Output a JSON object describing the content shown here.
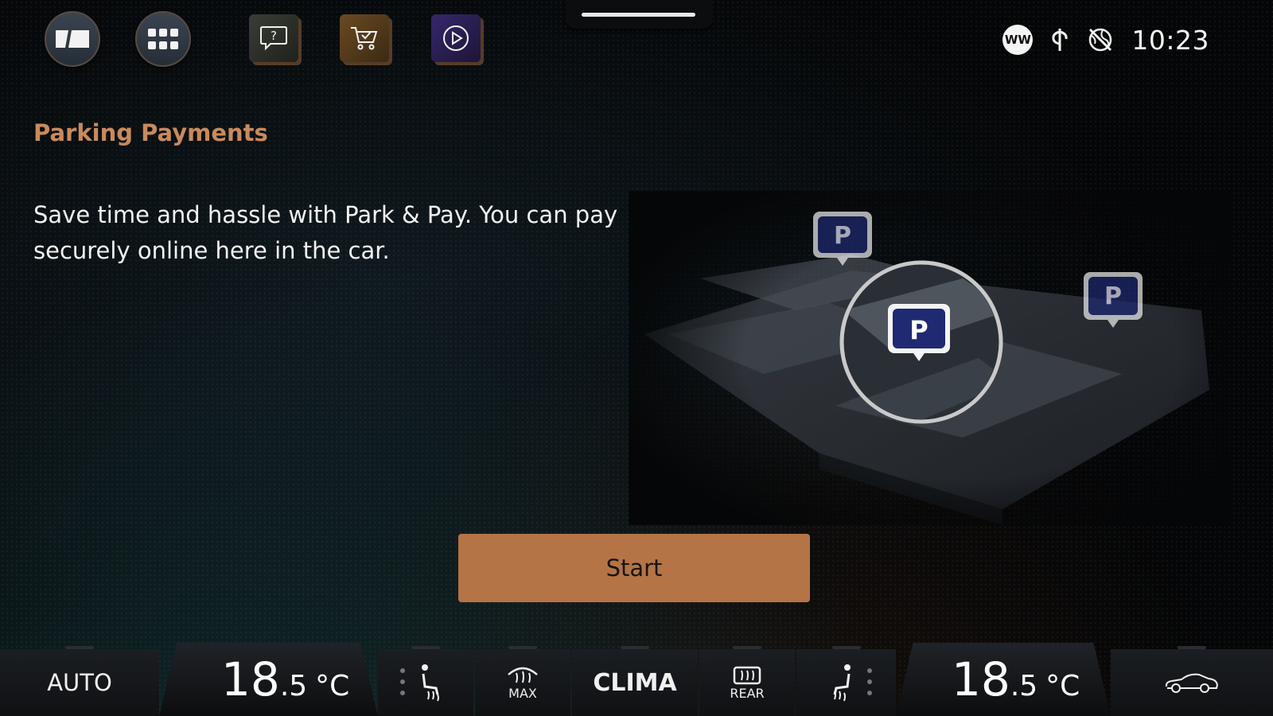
{
  "topbar": {
    "icons": [
      "home-split-icon",
      "app-grid-icon",
      "help-chat-icon",
      "store-cart-icon",
      "media-play-icon"
    ],
    "status_badge": "WW",
    "clock": "10:23"
  },
  "main": {
    "title": "Parking Payments",
    "description": "Save time and hassle with Park & Pay. You can pay securely online here in the car.",
    "start_label": "Start",
    "parking_marker": "P"
  },
  "climate": {
    "auto_label": "AUTO",
    "left_temp": {
      "whole": "18",
      "decimal": ".5",
      "unit": "°C"
    },
    "right_temp": {
      "whole": "18",
      "decimal": ".5",
      "unit": "°C"
    },
    "max_label": "MAX",
    "clima_label": "CLIMA",
    "rear_label": "REAR"
  },
  "colors": {
    "accent": "#c98a5c",
    "button": "#b57446",
    "background": "#050607"
  }
}
